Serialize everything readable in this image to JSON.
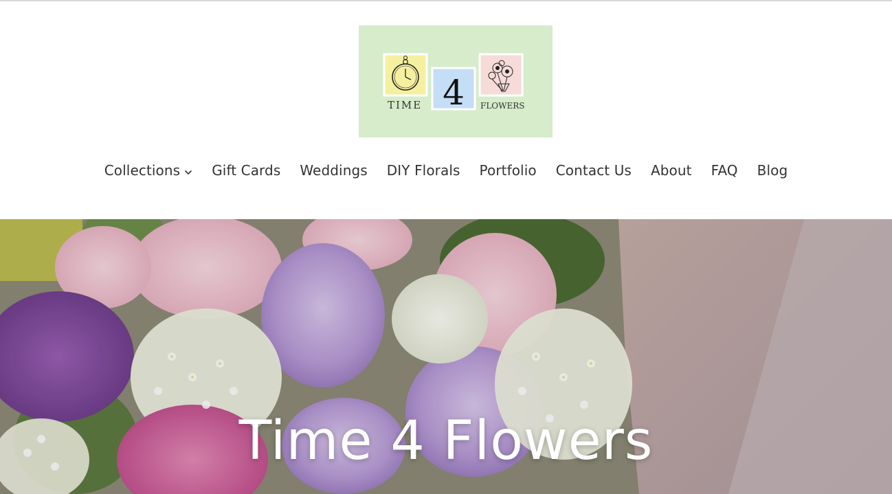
{
  "brand": {
    "logo_top_left": "TIME",
    "logo_number": "4",
    "logo_bottom_right": "FLOWERS",
    "logo_bg": "#d6ecca",
    "tile_yellow": "#f5f0a0",
    "tile_blue": "#c4def5",
    "tile_pink": "#f6dbd9"
  },
  "nav": {
    "items": [
      {
        "label": "Collections",
        "icon": "chevron-down-icon"
      },
      {
        "label": "Gift Cards"
      },
      {
        "label": "Weddings"
      },
      {
        "label": "DIY Florals"
      },
      {
        "label": "Portfolio"
      },
      {
        "label": "Contact Us"
      },
      {
        "label": "About"
      },
      {
        "label": "FAQ"
      },
      {
        "label": "Blog"
      }
    ]
  },
  "hero": {
    "title": "Time 4 Flowers",
    "image_name": "flower-bouquet-image"
  }
}
